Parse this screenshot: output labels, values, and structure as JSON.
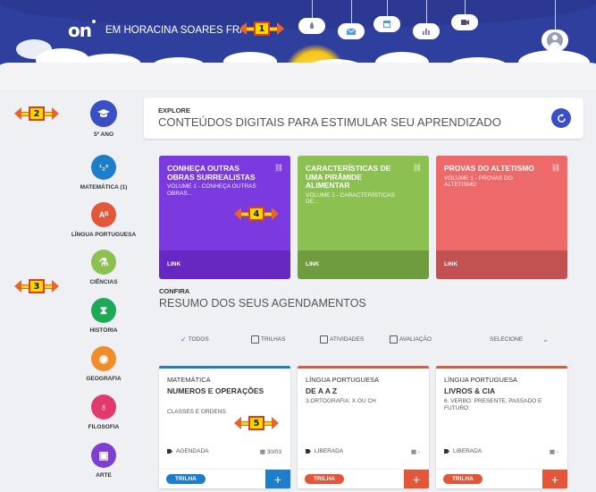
{
  "header": {
    "logo": "on",
    "school": "EM HORACINA SOARES FRA",
    "clouds": [
      {
        "icon": "rocket-icon"
      },
      {
        "icon": "mail-icon"
      },
      {
        "icon": "calendar-icon"
      },
      {
        "icon": "chart-icon"
      },
      {
        "icon": "video-icon"
      }
    ],
    "user_icon": "user-avatar-icon"
  },
  "callouts": [
    "1",
    "2",
    "3",
    "4",
    "5"
  ],
  "sidebar": {
    "grade": {
      "label": "5º ANO",
      "icon": "graduation-cap-icon",
      "color": "#3b4fc4"
    },
    "items": [
      {
        "label": "MATEMÁTICA (1)",
        "icon": "math-icon",
        "glyph": "¹₂³",
        "color": "#1f7ecc"
      },
      {
        "label": "LÍNGUA PORTUGUESA",
        "icon": "language-icon",
        "glyph": "Aᴮ",
        "color": "#e2573a"
      },
      {
        "label": "CIÊNCIAS",
        "icon": "flask-icon",
        "glyph": "⚗",
        "color": "#8cc152"
      },
      {
        "label": "HISTÓRIA",
        "icon": "hourglass-icon",
        "glyph": "⧗",
        "color": "#1eaa55"
      },
      {
        "label": "GEOGRAFIA",
        "icon": "globe-icon",
        "glyph": "◉",
        "color": "#f08d2a"
      },
      {
        "label": "FILOSOFIA",
        "icon": "lightbulb-icon",
        "glyph": "♁",
        "color": "#e23a6d"
      },
      {
        "label": "ARTE",
        "icon": "image-icon",
        "glyph": "▣",
        "color": "#7b3fd1"
      }
    ]
  },
  "explore": {
    "small": "EXPLORE",
    "big": "CONTEÚDOS DIGITAIS PARA ESTIMULAR SEU APRENDIZADO"
  },
  "cards": [
    {
      "title": "CONHEÇA OUTRAS OBRAS SURREALISTAS",
      "subtitle": "VOLUME 1 - CONHEÇA OUTRAS OBRAS...",
      "footer": "LINK",
      "color": "#7b3ae0",
      "footer_color": "#6628c0"
    },
    {
      "title": "CARACTERÍSTICAS DE UMA PIRÂMIDE ALIMENTAR",
      "subtitle": "VOLUME 1 - CARACTERÍSTICAS DE...",
      "footer": "LINK",
      "color": "#8cc152",
      "footer_color": "#6e9c3e"
    },
    {
      "title": "PROVAS DO ALTETISMO",
      "subtitle": "VOLUME 1 - PROVAS DO ALTETISMO",
      "footer": "LINK",
      "color": "#ee6a6a",
      "footer_color": "#c25252"
    }
  ],
  "confira": {
    "small": "CONFIRA",
    "big": "RESUMO DOS SEUS AGENDAMENTOS"
  },
  "filters": {
    "all": "TODOS",
    "trilhas": "TRILHAS",
    "atividades": "ATIVIDADES",
    "avaliacao": "AVALIAÇÃO",
    "select": "SELECIONE"
  },
  "schedule": [
    {
      "subject": "MATEMÁTICA",
      "topic": "NUMEROS E OPERAÇÕES",
      "desc": "CLASSES E ORDENS",
      "status": "AGENDADA",
      "date": "30/03",
      "badge": "TRILHA",
      "accent": "#1f7ecc"
    },
    {
      "subject": "LÍNGUA PORTUGUESA",
      "topic": "DE A A Z",
      "desc": "3.ORTOGRAFIA: X OU CH",
      "status": "LIBERADA",
      "date": "-",
      "badge": "TRILHA",
      "accent": "#e2573a"
    },
    {
      "subject": "LÍNGUA PORTUGUESA",
      "topic": "LIVROS & CIA",
      "desc": "6. VERBO: PRESENTE, PASSADO E FUTURO",
      "status": "LIBERADA",
      "date": "-",
      "badge": "TRILHA",
      "accent": "#e2573a"
    }
  ]
}
